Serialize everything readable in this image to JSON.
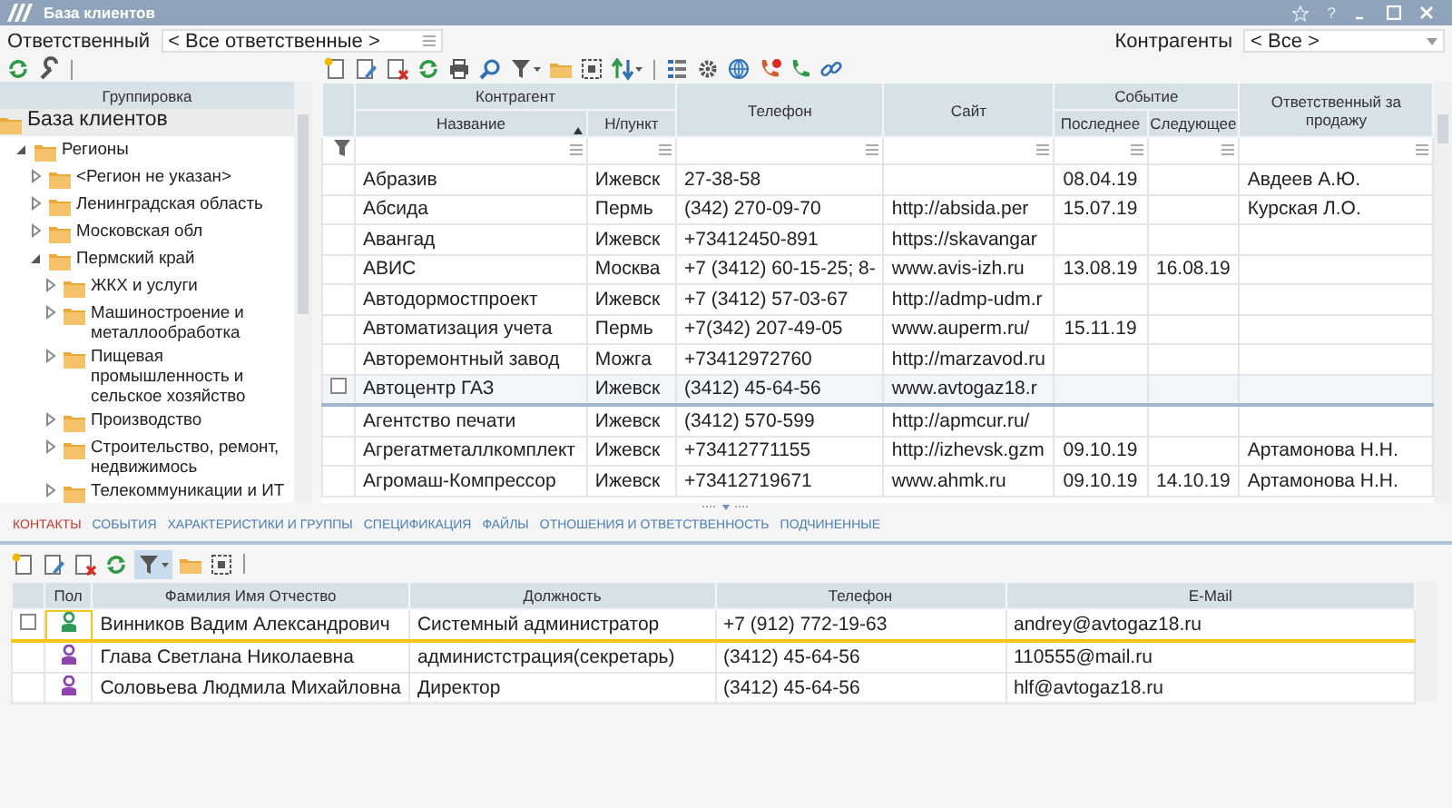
{
  "window": {
    "title": "База клиентов",
    "help": "?"
  },
  "filters": {
    "responsible_label": "Ответственный",
    "responsible_value": "< Все ответственные >",
    "counterparties_label": "Контрагенты",
    "counterparties_value": "< Все >"
  },
  "tree": {
    "title": "Группировка",
    "root": {
      "label": "База клиентов",
      "selected": true,
      "children": [
        {
          "label": "Регионы",
          "expanded": true,
          "selected": false,
          "children": [
            {
              "label": "<Регион не указан>",
              "expanded": false,
              "selected": false
            },
            {
              "label": "Ленинградская область",
              "expanded": false,
              "selected": false
            },
            {
              "label": "Московская обл",
              "expanded": false,
              "selected": false
            },
            {
              "label": "Пермский край",
              "expanded": true,
              "selected": false,
              "children": [
                {
                  "label": "ЖКХ и услуги",
                  "expanded": false,
                  "selected": false
                },
                {
                  "label": "Машиностроение и металлообработка",
                  "expanded": false,
                  "selected": false
                },
                {
                  "label": "Пищевая промышленность и сельское хозяйство",
                  "expanded": false,
                  "selected": false
                },
                {
                  "label": "Производство",
                  "expanded": false,
                  "selected": false
                },
                {
                  "label": "Строительство, ремонт, недвижимось",
                  "expanded": false,
                  "selected": false
                },
                {
                  "label": "Телекоммуникации и ИТ",
                  "expanded": false,
                  "selected": false
                }
              ]
            }
          ]
        }
      ]
    }
  },
  "table": {
    "groups": [
      {
        "label": "Контрагент",
        "columns": [
          {
            "label": "Название",
            "sorted": true
          },
          {
            "label": "Н/пункт",
            "sorted": false
          }
        ]
      },
      {
        "label": "Телефон"
      },
      {
        "label": "Сайт"
      },
      {
        "label": "Событие",
        "columns": [
          {
            "label": "Последнее",
            "sorted": false
          },
          {
            "label": "Следующее",
            "sorted": false
          }
        ]
      },
      {
        "label": "Ответственный за продажу"
      }
    ],
    "rows": [
      {
        "name": "Абразив",
        "city": "Ижевск",
        "phone": "27-38-58",
        "last": "08.04.19",
        "responsible": "Авдеев А.Ю.",
        "selected": false
      },
      {
        "name": "Абсида",
        "city": "Пермь",
        "phone": "(342) 270-09-70",
        "site": "http://absida.per",
        "last": "15.07.19",
        "responsible": "Курская Л.О.",
        "selected": false
      },
      {
        "name": "Авангад",
        "city": "Ижевск",
        "phone": "+73412450-891",
        "site": "https://skavangar",
        "selected": false
      },
      {
        "name": "АВИС",
        "city": "Москва",
        "phone": "+7 (3412) 60-15-25; 8-",
        "site": "www.avis-izh.ru",
        "last": "13.08.19",
        "next": "16.08.19",
        "selected": false
      },
      {
        "name": "Автодормостпроект",
        "city": "Ижевск",
        "phone": "+7 (3412) 57-03-67",
        "site": "http://admp-udm.r",
        "selected": false
      },
      {
        "name": "Автоматизация учета",
        "city": "Пермь",
        "phone": "+7(342) 207-49-05",
        "site": "www.auperm.ru/",
        "last": "15.11.19",
        "selected": false
      },
      {
        "name": "Авторемонтный завод",
        "city": "Можга",
        "phone": "+73412972760",
        "site": "http://marzavod.ru",
        "selected": false
      },
      {
        "name": "Автоцентр ГАЗ",
        "city": "Ижевск",
        "phone": "(3412) 45-64-56",
        "site": "www.avtogaz18.r",
        "selected": true
      },
      {
        "name": "Агентство печати",
        "city": "Ижевск",
        "phone": "(3412) 570-599",
        "site": "http://apmcur.ru/",
        "selected": false
      },
      {
        "name": "Агрегатметаллкомплект",
        "city": "Ижевск",
        "phone": "+73412771155",
        "site": "http://izhevsk.gzm",
        "last": "09.10.19",
        "responsible": "Артамонова Н.Н.",
        "selected": false
      },
      {
        "name": "Агромаш-Компрессор",
        "city": "Ижевск",
        "phone": "+73412719671",
        "site": "www.ahmk.ru",
        "last": "09.10.19",
        "next": "14.10.19",
        "responsible": "Артамонова Н.Н.",
        "selected": false
      }
    ]
  },
  "tabs": [
    {
      "label": "КОНТАКТЫ",
      "selected": true
    },
    {
      "label": "СОБЫТИЯ",
      "selected": false
    },
    {
      "label": "ХАРАКТЕРИСТИКИ И ГРУППЫ",
      "selected": false
    },
    {
      "label": "СПЕЦИФИКАЦИЯ",
      "selected": false
    },
    {
      "label": "ФАЙЛЫ",
      "selected": false
    },
    {
      "label": "ОТНОШЕНИЯ И ОТВЕТСТВЕННОСТЬ",
      "selected": false
    },
    {
      "label": "ПОДЧИНЕННЫЕ",
      "selected": false
    }
  ],
  "contacts": {
    "filter_active": true,
    "columns": [
      "Пол",
      "Фамилия Имя Отчество",
      "Должность",
      "Телефон",
      "E-Mail"
    ],
    "rows": [
      {
        "kind": "male",
        "name": "Винников Вадим Александрович",
        "position": "Системный администратор",
        "phone": "+7 (912) 772-19-63",
        "email": "andrey@avtogaz18.ru",
        "selected": true
      },
      {
        "kind": "female",
        "name": "Глава Светлана Николаевна",
        "position": "администстрация(секретарь)",
        "phone": "(3412) 45-64-56",
        "email": "110555@mail.ru",
        "selected": false
      },
      {
        "kind": "female",
        "name": "Соловьева Людмила Михайловна",
        "position": "Директор",
        "phone": "(3412) 45-64-56",
        "email": "hlf@avtogaz18.ru",
        "selected": false
      }
    ]
  }
}
